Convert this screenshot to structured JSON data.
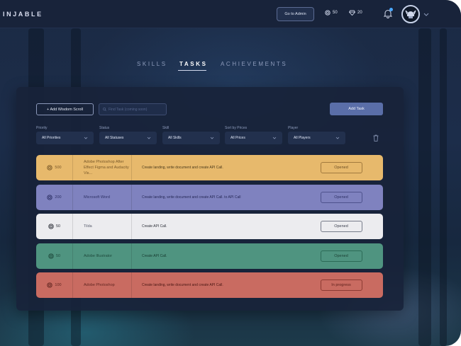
{
  "app": {
    "logo": "INJABLE"
  },
  "topbar": {
    "admin_button": "Go to Admin",
    "coins": "50",
    "gems": "20"
  },
  "tabs": [
    {
      "label": "SKILLS",
      "active": false
    },
    {
      "label": "TASKS",
      "active": true
    },
    {
      "label": "ACHIEVEMENTS",
      "active": false
    }
  ],
  "toolbar": {
    "add_scroll_label": "+ Add Wisdom Scroll",
    "search_placeholder": "Find Task (coming soon)",
    "add_task_label": "Add Task"
  },
  "filters": [
    {
      "label": "Priority",
      "value": "All Priorities"
    },
    {
      "label": "Status",
      "value": "All Statuses"
    },
    {
      "label": "Skill",
      "value": "All Skills"
    },
    {
      "label": "Sort by Prices",
      "value": "All Prices"
    },
    {
      "label": "Player",
      "value": "All Players"
    }
  ],
  "tasks": [
    {
      "price": "500",
      "skill": "Adobe Photoshop After Effect Figma and Audacity Vis...",
      "description": "Create landing, write document and create API Call.",
      "status": "Opened",
      "color": "#e7b96c"
    },
    {
      "price": "200",
      "skill": "Microsoft Word",
      "description": "Create landing, write document and create API Call. to API Call",
      "status": "Opened",
      "color": "#7f82bf"
    },
    {
      "price": "50",
      "skill": "Tilda",
      "description": "Create API Call.",
      "status": "Opened",
      "color": "#ececef"
    },
    {
      "price": "50",
      "skill": "Adobe Illustrator",
      "description": "Create API Call.",
      "status": "Opened",
      "color": "#4f9480"
    },
    {
      "price": "100",
      "skill": "Adobe Photoshop",
      "description": "Create landing, write document and create API Call.",
      "status": "In progress",
      "color": "#c96b61"
    }
  ],
  "colors": {
    "accent": "#5a6ea8",
    "notification_dot": "#4aa8ff"
  }
}
